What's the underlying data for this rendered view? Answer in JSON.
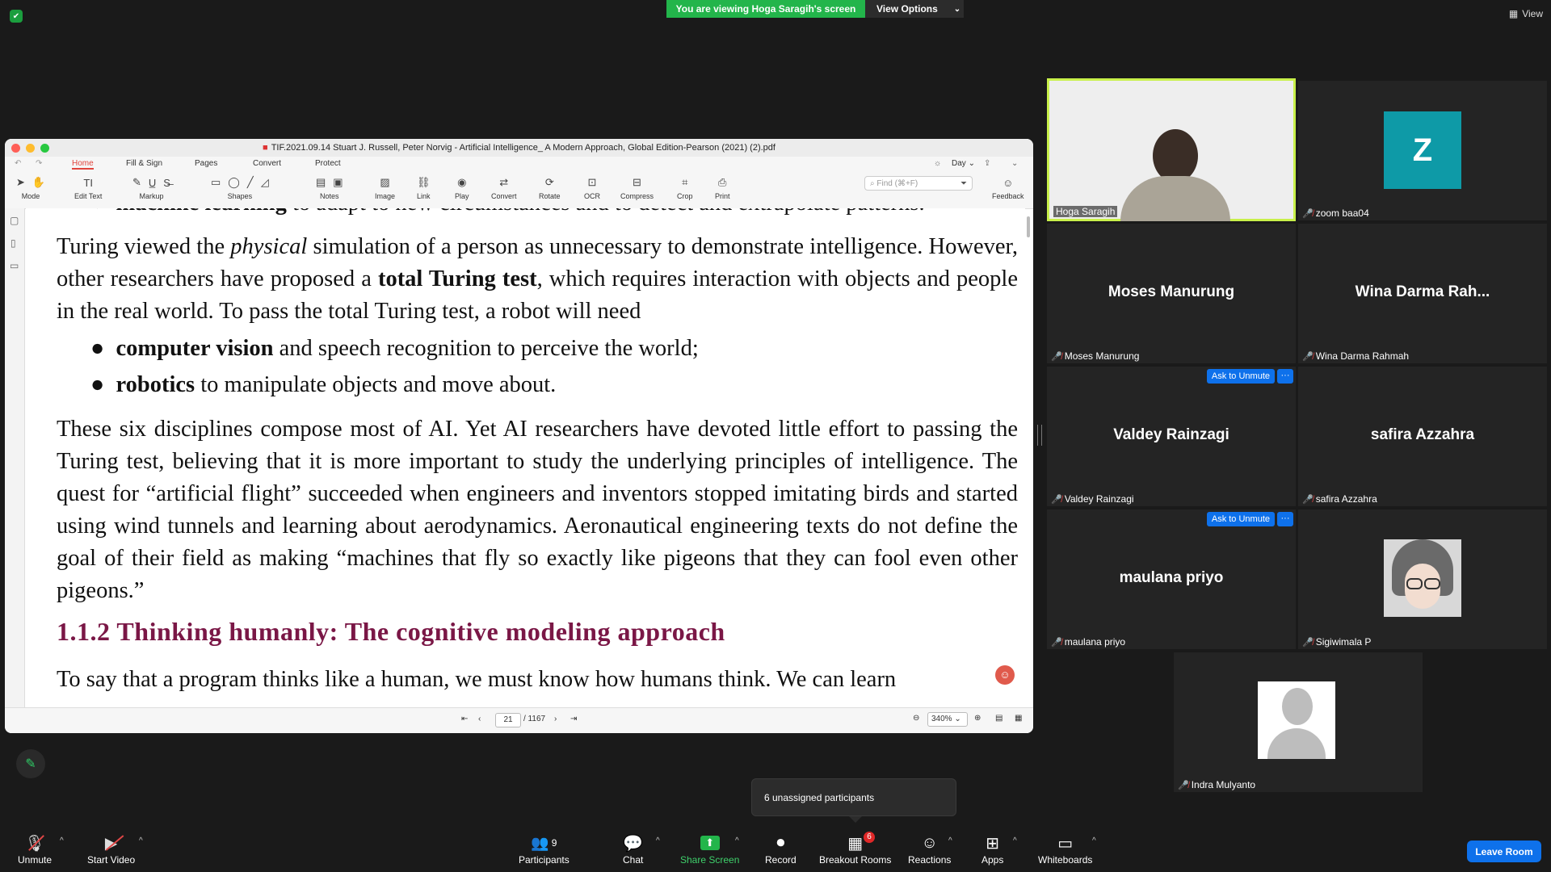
{
  "banner": {
    "viewing": "You are viewing Hoga Saragih's screen",
    "view_options": "View Options",
    "view": "View"
  },
  "pdf": {
    "title": "TIF.2021.09.14 Stuart J. Russell, Peter Norvig - Artificial Intelligence_ A Modern Approach, Global Edition-Pearson (2021) (2).pdf",
    "tabs": [
      "Home",
      "Fill & Sign",
      "Pages",
      "Convert",
      "Protect"
    ],
    "theme": "Day",
    "tools": [
      "Mode",
      "Edit Text",
      "Markup",
      "Shapes",
      "Notes",
      "Image",
      "Link",
      "Play",
      "Convert",
      "Rotate",
      "OCR",
      "Compress",
      "Crop",
      "Print",
      "Feedback"
    ],
    "find_placeholder": "Find (⌘+F)",
    "top_partial_bold": "machine learning",
    "top_partial_rest": " to adapt to new circumstances and to detect and extrapolate patterns.",
    "p1_a": "Turing viewed the ",
    "p1_italic": "physical",
    "p1_b": " simulation of a person as unnecessary to demonstrate intelligence. However, other researchers have proposed a ",
    "p1_bold": "total Turing test",
    "p1_c": ", which requires interaction with objects and people in the real world. To pass the total Turing test, a robot will need",
    "b1_bold": "computer vision",
    "b1_rest": " and speech recognition to perceive the world;",
    "b2_bold": "robotics",
    "b2_rest": " to manipulate objects and move about.",
    "p2": "These six disciplines compose most of AI. Yet AI researchers have devoted little effort to passing the Turing test, believing that it is more important to study the underlying principles of intelligence. The quest for “artificial flight” succeeded when engineers and inventors stopped imitating birds and started using wind tunnels and learning about aerodynamics. Aeronautical engineering texts do not define the goal of their field as making “machines that fly so exactly like pigeons that they can fool even other pigeons.”",
    "heading": "1.1.2  Thinking humanly:  The cognitive modeling approach",
    "p3": "To say that a program thinks like a human, we must know how humans think. We can learn",
    "page_current": "21",
    "page_total": "/ 1167",
    "zoom": "340%"
  },
  "participants": [
    {
      "name": "Hoga Saragih",
      "label": "Hoga Saragih"
    },
    {
      "name": "Z",
      "label": "zoom baa04"
    },
    {
      "name": "Moses Manurung",
      "label": "Moses Manurung"
    },
    {
      "name": "Wina Darma Rah...",
      "label": "Wina Darma Rahmah"
    },
    {
      "name": "Valdey Rainzagi",
      "label": "Valdey Rainzagi"
    },
    {
      "name": "safira Azzahra",
      "label": "safira Azzahra"
    },
    {
      "name": "maulana priyo",
      "label": "maulana priyo"
    },
    {
      "name": "",
      "label": "Sigiwimala P"
    },
    {
      "name": "",
      "label": "Indra Mulyanto"
    }
  ],
  "ask_to_unmute": "Ask to Unmute",
  "more": "···",
  "toolbar": {
    "unmute": "Unmute",
    "start_video": "Start Video",
    "participants": "Participants",
    "participants_count": "9",
    "chat": "Chat",
    "share_screen": "Share Screen",
    "record": "Record",
    "breakout_rooms": "Breakout Rooms",
    "breakout_badge": "6",
    "reactions": "Reactions",
    "apps": "Apps",
    "whiteboards": "Whiteboards",
    "leave_room": "Leave Room"
  },
  "tooltip": "6 unassigned participants",
  "colors": {
    "share_green": "#23b54b",
    "zoom_blue": "#0e71eb",
    "heading": "#7a1746",
    "avatar_z": "#0e9aa7"
  }
}
